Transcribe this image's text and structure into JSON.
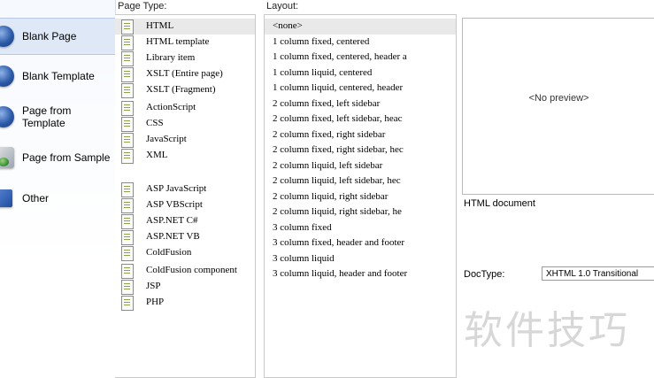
{
  "headers": {
    "page_type": "Page Type:",
    "layout": "Layout:"
  },
  "categories": [
    {
      "label": "Blank Page",
      "icon": "blank-page-icon",
      "selected": true
    },
    {
      "label": "Blank Template",
      "icon": "blank-template-icon",
      "selected": false
    },
    {
      "label": "Page from Template",
      "icon": "page-from-template-icon",
      "selected": false
    },
    {
      "label": "Page from Sample",
      "icon": "page-from-sample-icon",
      "selected": false
    },
    {
      "label": "Other",
      "icon": "other-icon",
      "selected": false
    }
  ],
  "page_types": [
    {
      "label": "HTML",
      "selected": true
    },
    {
      "label": "HTML template"
    },
    {
      "label": "Library item"
    },
    {
      "label": "XSLT (Entire page)"
    },
    {
      "label": "XSLT (Fragment)"
    },
    {
      "label": "ActionScript"
    },
    {
      "label": "CSS"
    },
    {
      "label": "JavaScript"
    },
    {
      "label": "XML"
    },
    {
      "label": "ASP JavaScript"
    },
    {
      "label": "ASP VBScript"
    },
    {
      "label": "ASP.NET C#"
    },
    {
      "label": "ASP.NET VB"
    },
    {
      "label": "ColdFusion"
    },
    {
      "label": "ColdFusion component"
    },
    {
      "label": "JSP"
    },
    {
      "label": "PHP"
    }
  ],
  "layouts": [
    {
      "label": "<none>",
      "selected": true
    },
    {
      "label": "1 column fixed, centered"
    },
    {
      "label": "1 column fixed, centered, header a"
    },
    {
      "label": "1 column liquid, centered"
    },
    {
      "label": "1 column liquid, centered, header"
    },
    {
      "label": "2 column fixed, left sidebar"
    },
    {
      "label": "2 column fixed, left sidebar, heac"
    },
    {
      "label": "2 column fixed, right sidebar"
    },
    {
      "label": "2 column fixed, right sidebar, hec"
    },
    {
      "label": "2 column liquid, left sidebar"
    },
    {
      "label": "2 column liquid, left sidebar, hec"
    },
    {
      "label": "2 column liquid, right sidebar"
    },
    {
      "label": "2 column liquid, right sidebar, he"
    },
    {
      "label": "3 column fixed"
    },
    {
      "label": "3 column fixed, header and footer"
    },
    {
      "label": "3 column liquid"
    },
    {
      "label": "3 column liquid, header and footer"
    }
  ],
  "preview": {
    "text": "<No preview>",
    "description": "HTML document"
  },
  "doctype": {
    "label": "DocType:",
    "value": "XHTML 1.0 Transitional"
  },
  "watermark": "软件技巧",
  "colors": {
    "selection": "#dfe8f7",
    "list_selection": "#e9e9e9"
  }
}
